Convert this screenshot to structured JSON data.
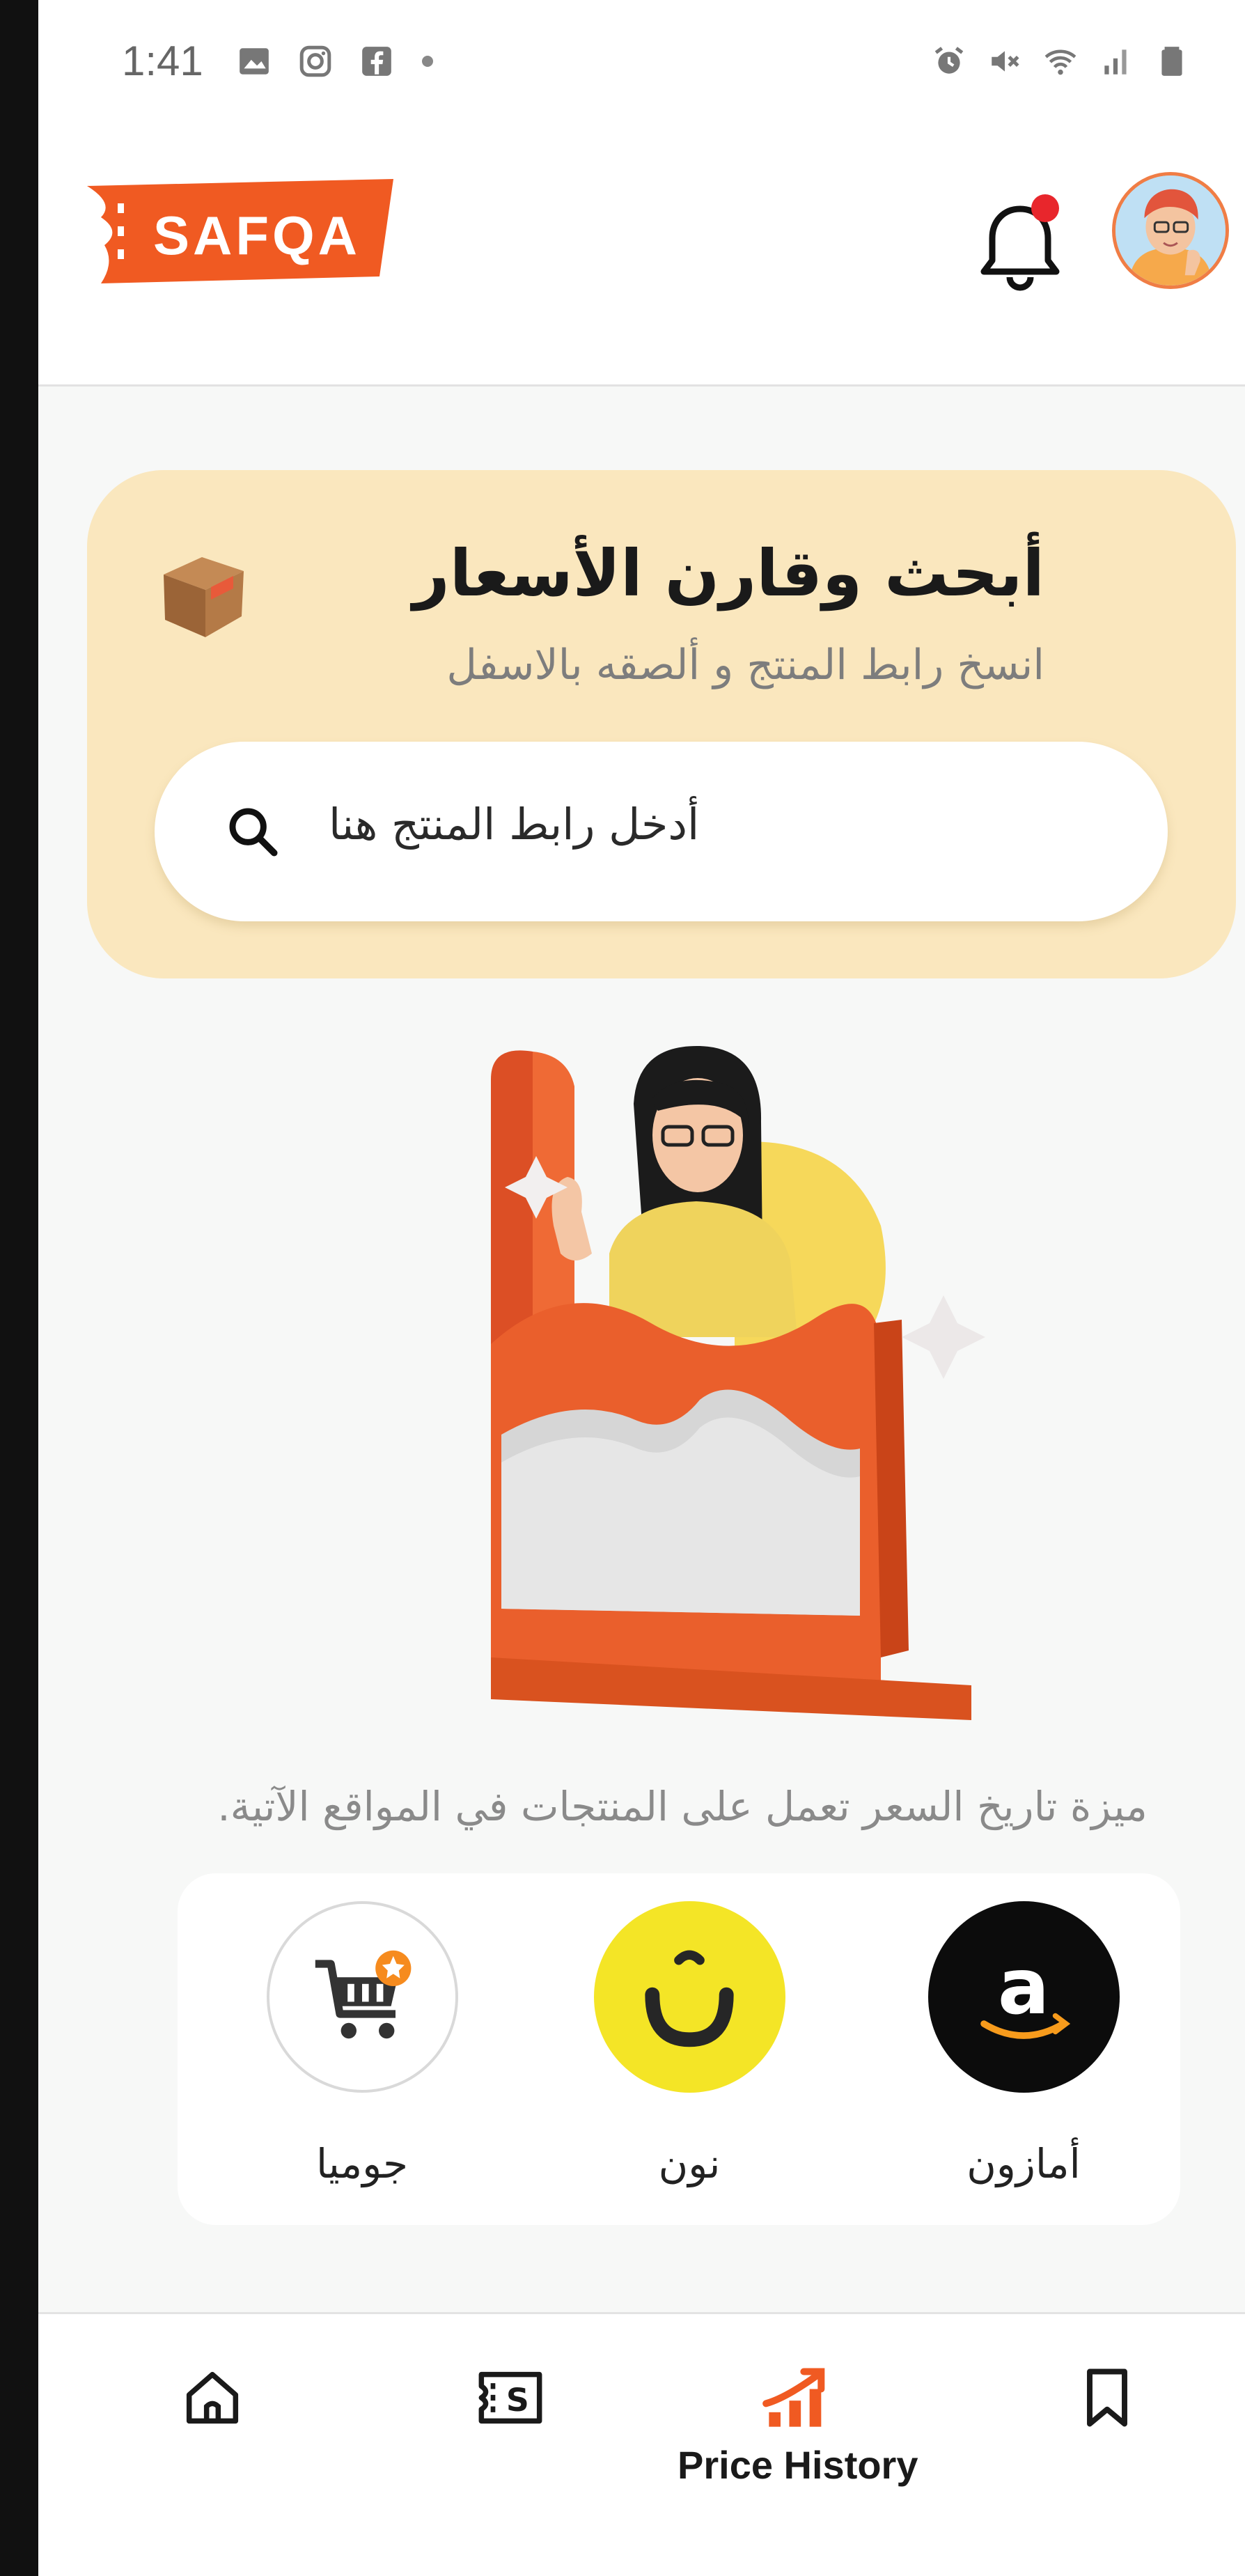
{
  "status_bar": {
    "time": "1:41",
    "left_icons": [
      "gallery-icon",
      "instagram-icon",
      "facebook-icon",
      "dot-icon"
    ],
    "right_icons": [
      "alarm-icon",
      "mute-icon",
      "wifi-icon",
      "signal-icon",
      "battery-icon"
    ]
  },
  "header": {
    "logo_text": "SAFQA",
    "brand_color": "#f05a22",
    "notification_dot_color": "#e8262c"
  },
  "search_card": {
    "title": "أبحث وقارن الأسعار",
    "subtitle": "انسخ رابط المنتج و ألصقه بالاسفل",
    "placeholder": "أدخل رابط المنتج هنا"
  },
  "sites": {
    "caption": "ميزة تاريخ السعر تعمل على المنتجات في المواقع الآتية.",
    "items": [
      {
        "label": "أمازون",
        "logo": "amazon-logo"
      },
      {
        "label": "نون",
        "logo": "noon-logo"
      },
      {
        "label": "جوميا",
        "logo": "jumia-logo"
      }
    ]
  },
  "bottom_nav": {
    "items": [
      {
        "icon": "home-icon",
        "label": ""
      },
      {
        "icon": "coupon-icon",
        "label": ""
      },
      {
        "icon": "price-history-icon",
        "label": "Price History"
      },
      {
        "icon": "bookmark-icon",
        "label": ""
      }
    ]
  }
}
